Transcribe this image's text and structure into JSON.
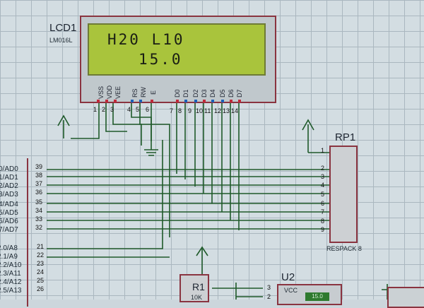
{
  "lcd": {
    "ref": "LCD1",
    "model": "LM016L",
    "line1": "H20 L10",
    "line2": "15.0",
    "pin_labels": [
      "VSS",
      "VDD",
      "VEE",
      "RS",
      "RW",
      "E",
      "D0",
      "D1",
      "D2",
      "D3",
      "D4",
      "D5",
      "D6",
      "D7"
    ],
    "pin_numbers": [
      "1",
      "2",
      "3",
      "4",
      "5",
      "6",
      "7",
      "8",
      "9",
      "10",
      "11",
      "12",
      "13",
      "14"
    ]
  },
  "rp1": {
    "ref": "RP1",
    "model": "RESPACK 8",
    "pins": [
      "1",
      "2",
      "3",
      "4",
      "5",
      "6",
      "7",
      "8",
      "9"
    ]
  },
  "mcu": {
    "port0_labels": [
      "0/AD0",
      "1/AD1",
      "2/AD2",
      "3/AD3",
      "4/AD4",
      "5/AD5",
      "6/AD6",
      "7/AD7"
    ],
    "port0_pins": [
      "39",
      "38",
      "37",
      "36",
      "35",
      "34",
      "33",
      "32"
    ],
    "port2_labels": [
      "2.0/A8",
      "2.1/A9",
      "2.2/A10",
      "2.3/A11",
      "2.4/A12",
      "2.5/A13"
    ],
    "port2_pins": [
      "21",
      "22",
      "23",
      "24",
      "25",
      "26"
    ]
  },
  "r1": {
    "ref": "R1",
    "value": "10K"
  },
  "u2": {
    "ref": "U2",
    "vcc_label": "VCC",
    "readout": "15.0",
    "pins": [
      "3",
      "2"
    ]
  }
}
